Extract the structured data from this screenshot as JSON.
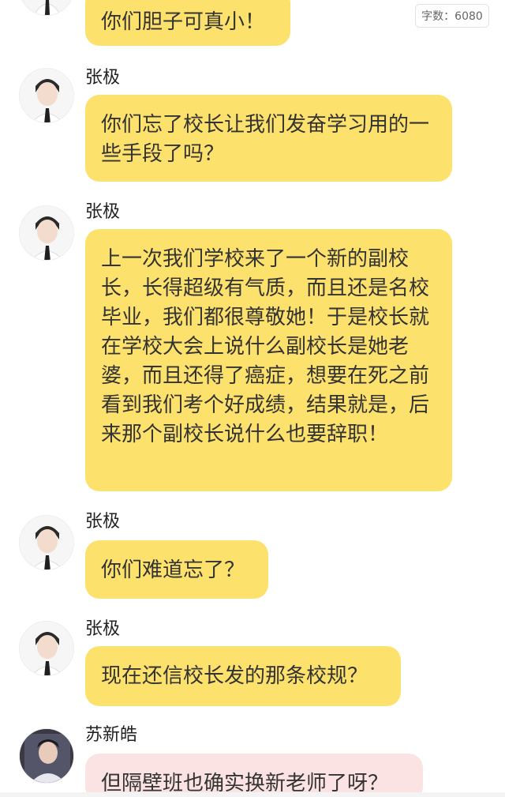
{
  "word_count": {
    "label": "字数：6080"
  },
  "messages": [
    {
      "sender": "",
      "text": "你们胆子可真小！",
      "style": "yellow"
    },
    {
      "sender": "张极",
      "text": "你们忘了校长让我们发奋学习用的一些手段了吗？",
      "style": "yellow"
    },
    {
      "sender": "张极",
      "text": "上一次我们学校来了一个新的副校长，长得超级有气质，而且还是名校毕业，我们都很尊敬她！于是校长就在学校大会上说什么副校长是她老婆，而且还得了癌症，想要在死之前看到我们考个好成绩，结果就是，后来那个副校长说什么也要辞职！",
      "style": "yellow"
    },
    {
      "sender": "张极",
      "text": "你们难道忘了？",
      "style": "yellow"
    },
    {
      "sender": "张极",
      "text": "现在还信校长发的那条校规？",
      "style": "yellow"
    },
    {
      "sender": "苏新皓",
      "text": "但隔壁班也确实换新老师了呀？",
      "style": "pink"
    }
  ],
  "colors": {
    "bubble_yellow": "#fde16d",
    "bubble_pink": "#fbe3e4"
  }
}
